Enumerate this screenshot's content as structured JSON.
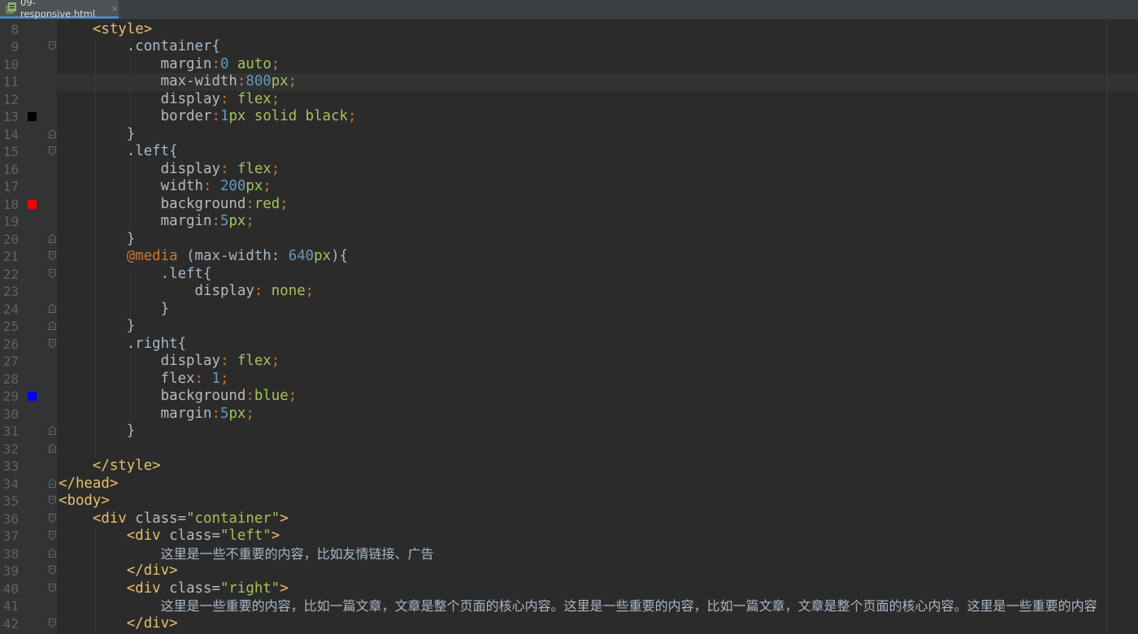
{
  "tab": {
    "filename": "09-responsive.html",
    "close_glyph": "×"
  },
  "editor": {
    "lines": [
      {
        "n": "8",
        "tokens": [
          [
            "ind",
            "    "
          ],
          [
            "t-tag",
            "<style>"
          ]
        ]
      },
      {
        "n": "9",
        "tokens": [
          [
            "ind",
            "        "
          ],
          [
            "t-sel",
            ".container"
          ],
          [
            "t-sel",
            "{"
          ]
        ]
      },
      {
        "n": "10",
        "tokens": [
          [
            "ind",
            "            "
          ],
          [
            "t-prop",
            "margin"
          ],
          [
            "t-punc",
            ":"
          ],
          [
            "t-num",
            "0"
          ],
          [
            "t-val",
            " auto"
          ],
          [
            "t-punc",
            ";"
          ]
        ]
      },
      {
        "n": "11",
        "tokens": [
          [
            "ind",
            "            "
          ],
          [
            "t-prop",
            "max-width"
          ],
          [
            "t-punc",
            ":"
          ],
          [
            "t-num",
            "800"
          ],
          [
            "t-val",
            "px"
          ],
          [
            "t-punc",
            ";"
          ]
        ]
      },
      {
        "n": "12",
        "tokens": [
          [
            "ind",
            "            "
          ],
          [
            "t-prop",
            "display"
          ],
          [
            "t-punc",
            ":"
          ],
          [
            "t-val",
            " flex"
          ],
          [
            "t-punc",
            ";"
          ]
        ]
      },
      {
        "n": "13",
        "swatch": "#000000",
        "tokens": [
          [
            "ind",
            "            "
          ],
          [
            "t-prop",
            "border"
          ],
          [
            "t-punc",
            ":"
          ],
          [
            "t-num",
            "1"
          ],
          [
            "t-val",
            "px solid black"
          ],
          [
            "t-punc",
            ";"
          ]
        ]
      },
      {
        "n": "14",
        "tokens": [
          [
            "ind",
            "        "
          ],
          [
            "t-sel",
            "}"
          ]
        ]
      },
      {
        "n": "15",
        "tokens": [
          [
            "ind",
            "        "
          ],
          [
            "t-sel",
            ".left"
          ],
          [
            "t-sel",
            "{"
          ]
        ]
      },
      {
        "n": "16",
        "tokens": [
          [
            "ind",
            "            "
          ],
          [
            "t-prop",
            "display"
          ],
          [
            "t-punc",
            ":"
          ],
          [
            "t-val",
            " flex"
          ],
          [
            "t-punc",
            ";"
          ]
        ]
      },
      {
        "n": "17",
        "tokens": [
          [
            "ind",
            "            "
          ],
          [
            "t-prop",
            "width"
          ],
          [
            "t-punc",
            ":"
          ],
          [
            "t-num",
            " 200"
          ],
          [
            "t-val",
            "px"
          ],
          [
            "t-punc",
            ";"
          ]
        ]
      },
      {
        "n": "18",
        "swatch": "#ff0000",
        "tokens": [
          [
            "ind",
            "            "
          ],
          [
            "t-prop",
            "background"
          ],
          [
            "t-punc",
            ":"
          ],
          [
            "t-val",
            "red"
          ],
          [
            "t-punc",
            ";"
          ]
        ]
      },
      {
        "n": "19",
        "tokens": [
          [
            "ind",
            "            "
          ],
          [
            "t-prop",
            "margin"
          ],
          [
            "t-punc",
            ":"
          ],
          [
            "t-num",
            "5"
          ],
          [
            "t-val",
            "px"
          ],
          [
            "t-punc",
            ";"
          ]
        ]
      },
      {
        "n": "20",
        "tokens": [
          [
            "ind",
            "        "
          ],
          [
            "t-sel",
            "}"
          ]
        ]
      },
      {
        "n": "21",
        "tokens": [
          [
            "ind",
            "        "
          ],
          [
            "t-at",
            "@media"
          ],
          [
            "t-sel",
            " (max-width: "
          ],
          [
            "t-num",
            "640"
          ],
          [
            "t-val",
            "px"
          ],
          [
            "t-sel",
            "){"
          ]
        ]
      },
      {
        "n": "22",
        "tokens": [
          [
            "ind",
            "            "
          ],
          [
            "t-sel",
            ".left"
          ],
          [
            "t-sel",
            "{"
          ]
        ]
      },
      {
        "n": "23",
        "tokens": [
          [
            "ind",
            "                "
          ],
          [
            "t-prop",
            "display"
          ],
          [
            "t-punc",
            ":"
          ],
          [
            "t-val",
            " none"
          ],
          [
            "t-punc",
            ";"
          ]
        ]
      },
      {
        "n": "24",
        "tokens": [
          [
            "ind",
            "            "
          ],
          [
            "t-sel",
            "}"
          ]
        ]
      },
      {
        "n": "25",
        "tokens": [
          [
            "ind",
            "        "
          ],
          [
            "t-sel",
            "}"
          ]
        ]
      },
      {
        "n": "26",
        "tokens": [
          [
            "ind",
            "        "
          ],
          [
            "t-sel",
            ".right"
          ],
          [
            "t-sel",
            "{"
          ]
        ]
      },
      {
        "n": "27",
        "tokens": [
          [
            "ind",
            "            "
          ],
          [
            "t-prop",
            "display"
          ],
          [
            "t-punc",
            ":"
          ],
          [
            "t-val",
            " flex"
          ],
          [
            "t-punc",
            ";"
          ]
        ]
      },
      {
        "n": "28",
        "tokens": [
          [
            "ind",
            "            "
          ],
          [
            "t-prop",
            "flex"
          ],
          [
            "t-punc",
            ":"
          ],
          [
            "t-num",
            " 1"
          ],
          [
            "t-punc",
            ";"
          ]
        ]
      },
      {
        "n": "29",
        "swatch": "#0000ff",
        "tokens": [
          [
            "ind",
            "            "
          ],
          [
            "t-prop",
            "background"
          ],
          [
            "t-punc",
            ":"
          ],
          [
            "t-val",
            "blue"
          ],
          [
            "t-punc",
            ";"
          ]
        ]
      },
      {
        "n": "30",
        "tokens": [
          [
            "ind",
            "            "
          ],
          [
            "t-prop",
            "margin"
          ],
          [
            "t-punc",
            ":"
          ],
          [
            "t-num",
            "5"
          ],
          [
            "t-val",
            "px"
          ],
          [
            "t-punc",
            ";"
          ]
        ]
      },
      {
        "n": "31",
        "tokens": [
          [
            "ind",
            "        "
          ],
          [
            "t-sel",
            "}"
          ]
        ]
      },
      {
        "n": "32",
        "tokens": []
      },
      {
        "n": "33",
        "tokens": [
          [
            "ind",
            "    "
          ],
          [
            "t-tag",
            "</style>"
          ]
        ]
      },
      {
        "n": "34",
        "tokens": [
          [
            "t-tag",
            "</head>"
          ]
        ]
      },
      {
        "n": "35",
        "tokens": [
          [
            "t-tag",
            "<body>"
          ]
        ]
      },
      {
        "n": "36",
        "tokens": [
          [
            "ind",
            "    "
          ],
          [
            "t-tag",
            "<div "
          ],
          [
            "t-attr",
            "class="
          ],
          [
            "t-str",
            "\"container\""
          ],
          [
            "t-tag",
            ">"
          ]
        ]
      },
      {
        "n": "37",
        "tokens": [
          [
            "ind",
            "        "
          ],
          [
            "t-tag",
            "<div "
          ],
          [
            "t-attr",
            "class="
          ],
          [
            "t-str",
            "\"left\""
          ],
          [
            "t-tag",
            ">"
          ]
        ]
      },
      {
        "n": "38",
        "tokens": [
          [
            "ind",
            "            "
          ],
          [
            "t-text",
            "这里是一些不重要的内容，比如友情链接、广告"
          ]
        ]
      },
      {
        "n": "39",
        "tokens": [
          [
            "ind",
            "        "
          ],
          [
            "t-tag",
            "</div>"
          ]
        ]
      },
      {
        "n": "40",
        "tokens": [
          [
            "ind",
            "        "
          ],
          [
            "t-tag",
            "<div "
          ],
          [
            "t-attr",
            "class="
          ],
          [
            "t-str",
            "\"right\""
          ],
          [
            "t-tag",
            ">"
          ]
        ]
      },
      {
        "n": "41",
        "tokens": [
          [
            "ind",
            "            "
          ],
          [
            "t-text",
            "这里是一些重要的内容，比如一篇文章，文章是整个页面的核心内容。这里是一些重要的内容，比如一篇文章，文章是整个页面的核心内容。这里是一些重要的内容"
          ]
        ]
      },
      {
        "n": "42",
        "tokens": [
          [
            "ind",
            "        "
          ],
          [
            "t-tag",
            "</div>"
          ]
        ]
      }
    ]
  }
}
